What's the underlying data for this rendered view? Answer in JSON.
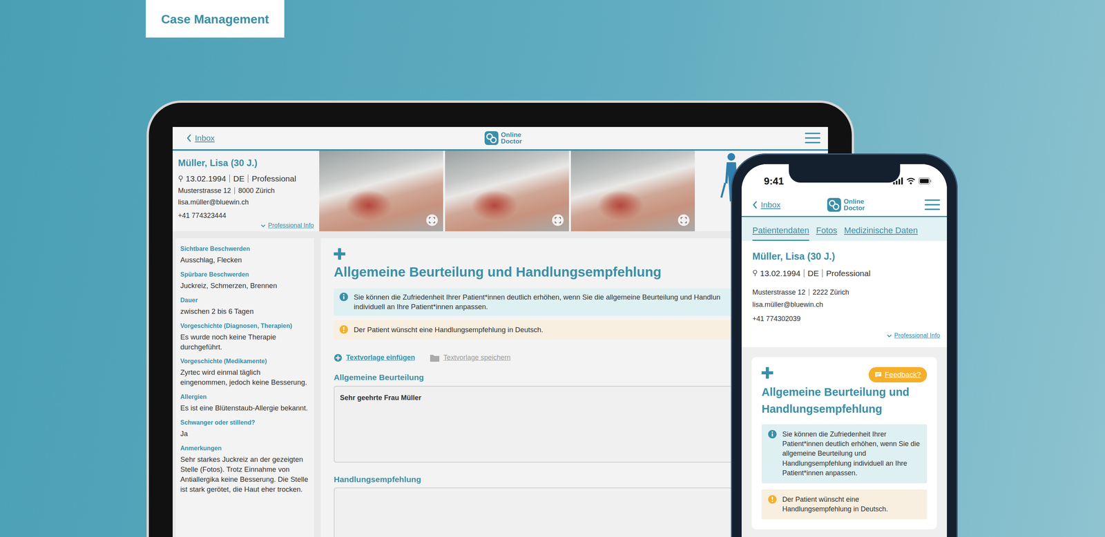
{
  "label": "Case Management",
  "tablet": {
    "nav": {
      "back": "Inbox",
      "logo": [
        "Online",
        "Doctor"
      ]
    },
    "patient": {
      "name": "Müller, Lisa (30 J.)",
      "meta": [
        "13.02.1994",
        "DE",
        "Professional"
      ],
      "street": "Musterstrasse 12",
      "city": "8000 Zürich",
      "email": "lisa.müller@bluewin.ch",
      "phone": "+41 774323444",
      "more": "Professional Info"
    },
    "details": [
      {
        "label": "Sichtbare Beschwerden",
        "value": "Ausschlag, Flecken"
      },
      {
        "label": "Spürbare Beschwerden",
        "value": "Juckreiz, Schmerzen, Brennen"
      },
      {
        "label": "Dauer",
        "value": "zwischen 2 bis 6 Tagen"
      },
      {
        "label": "Vorgeschichte (Diagnosen, Therapien)",
        "value": "Es wurde noch keine Therapie durchgeführt."
      },
      {
        "label": "Vorgeschichte (Medikamente)",
        "value": "Zyrtec wird einmal täglich eingenommen, jedoch keine Besserung."
      },
      {
        "label": "Allergien",
        "value": "Es ist eine Blütenstaub-Allergie bekannt."
      },
      {
        "label": "Schwanger oder stillend?",
        "value": "Ja"
      },
      {
        "label": "Anmerkungen",
        "value": "Sehr starkes Juckreiz an der gezeigten Stelle (Fotos). Trotz Einnahme von Antiallergika keine Besserung. Die Stelle ist stark gerötet, die Haut eher trocken."
      }
    ],
    "form": {
      "title": "Allgemeine Beurteilung und Handlungsempfehlung",
      "info": "Sie können die Zufriedenheit Ihrer Patient*innen deutlich erhöhen, wenn Sie die allgemeine Beurteilung und Handlun individuell an Ihre Patient*innen anpassen.",
      "warning": "Der Patient wünscht eine Handlungsempfehlung in Deutsch.",
      "actions": [
        {
          "label": "Textvorlage einfügen",
          "disabled": false
        },
        {
          "label": "Textvorlage speichern",
          "disabled": true
        }
      ],
      "fields": [
        {
          "label": "Allgemeine Beurteilung",
          "value": "Sehr geehrte Frau Müller"
        },
        {
          "label": "Handlungsempfehlung",
          "value": ""
        }
      ]
    }
  },
  "phone": {
    "time": "9:41",
    "nav": {
      "back": "Inbox",
      "logo": [
        "Online",
        "Doctor"
      ]
    },
    "tabs": [
      {
        "label": "Patientendaten",
        "selected": true
      },
      {
        "label": "Fotos",
        "selected": false
      },
      {
        "label": "Medizinische Daten",
        "selected": false
      }
    ],
    "patient": {
      "name": "Müller, Lisa (30 J.)",
      "meta": [
        "13.02.1994",
        "DE",
        "Professional"
      ],
      "street": "Musterstrasse 12",
      "city": "2222 Zürich",
      "email": "lisa.müller@bluewin.ch",
      "phone": "+41 774302039",
      "more": "Professional Info"
    },
    "form": {
      "feedback": "Feedback?",
      "title": "Allgemeine Beurteilung und Handlungsempfehlung",
      "info": "Sie können die Zufriedenheit Ihrer Patient*innen deutlich erhöhen, wenn Sie die allgemeine Beurteilung und Handlungsempfehlung individuell an Ihre Patient*innen anpassen.",
      "warning": "Der Patient wünscht eine Handlungsempfehlung in Deutsch."
    }
  }
}
